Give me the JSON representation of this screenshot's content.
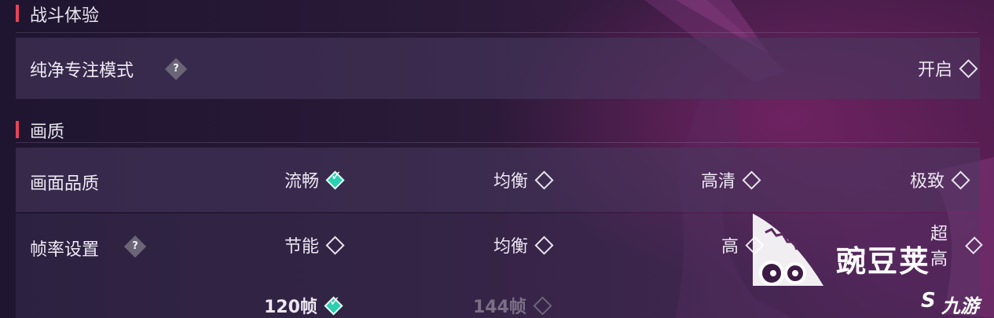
{
  "sections": {
    "combat": {
      "title": "战斗体验"
    },
    "graphics": {
      "title": "画质"
    }
  },
  "pure_focus": {
    "label": "纯净专注模式",
    "help": "?",
    "value": "开启"
  },
  "quality": {
    "label": "画面品质",
    "options": [
      "流畅",
      "均衡",
      "高清",
      "极致"
    ],
    "selected": "流畅"
  },
  "frame_rate": {
    "label": "帧率设置",
    "help": "?",
    "options": [
      "节能",
      "均衡",
      "高",
      "超高"
    ],
    "sub_options": [
      "120帧",
      "144帧"
    ],
    "selected_sub": "120帧",
    "disabled_sub": "144帧"
  },
  "watermarks": {
    "wandoujia": "豌豆荚",
    "jiuyou": "九游",
    "jiuyou_mark": "S"
  },
  "colors": {
    "accent": "#e8435a",
    "selected": "#2ad0b0"
  }
}
